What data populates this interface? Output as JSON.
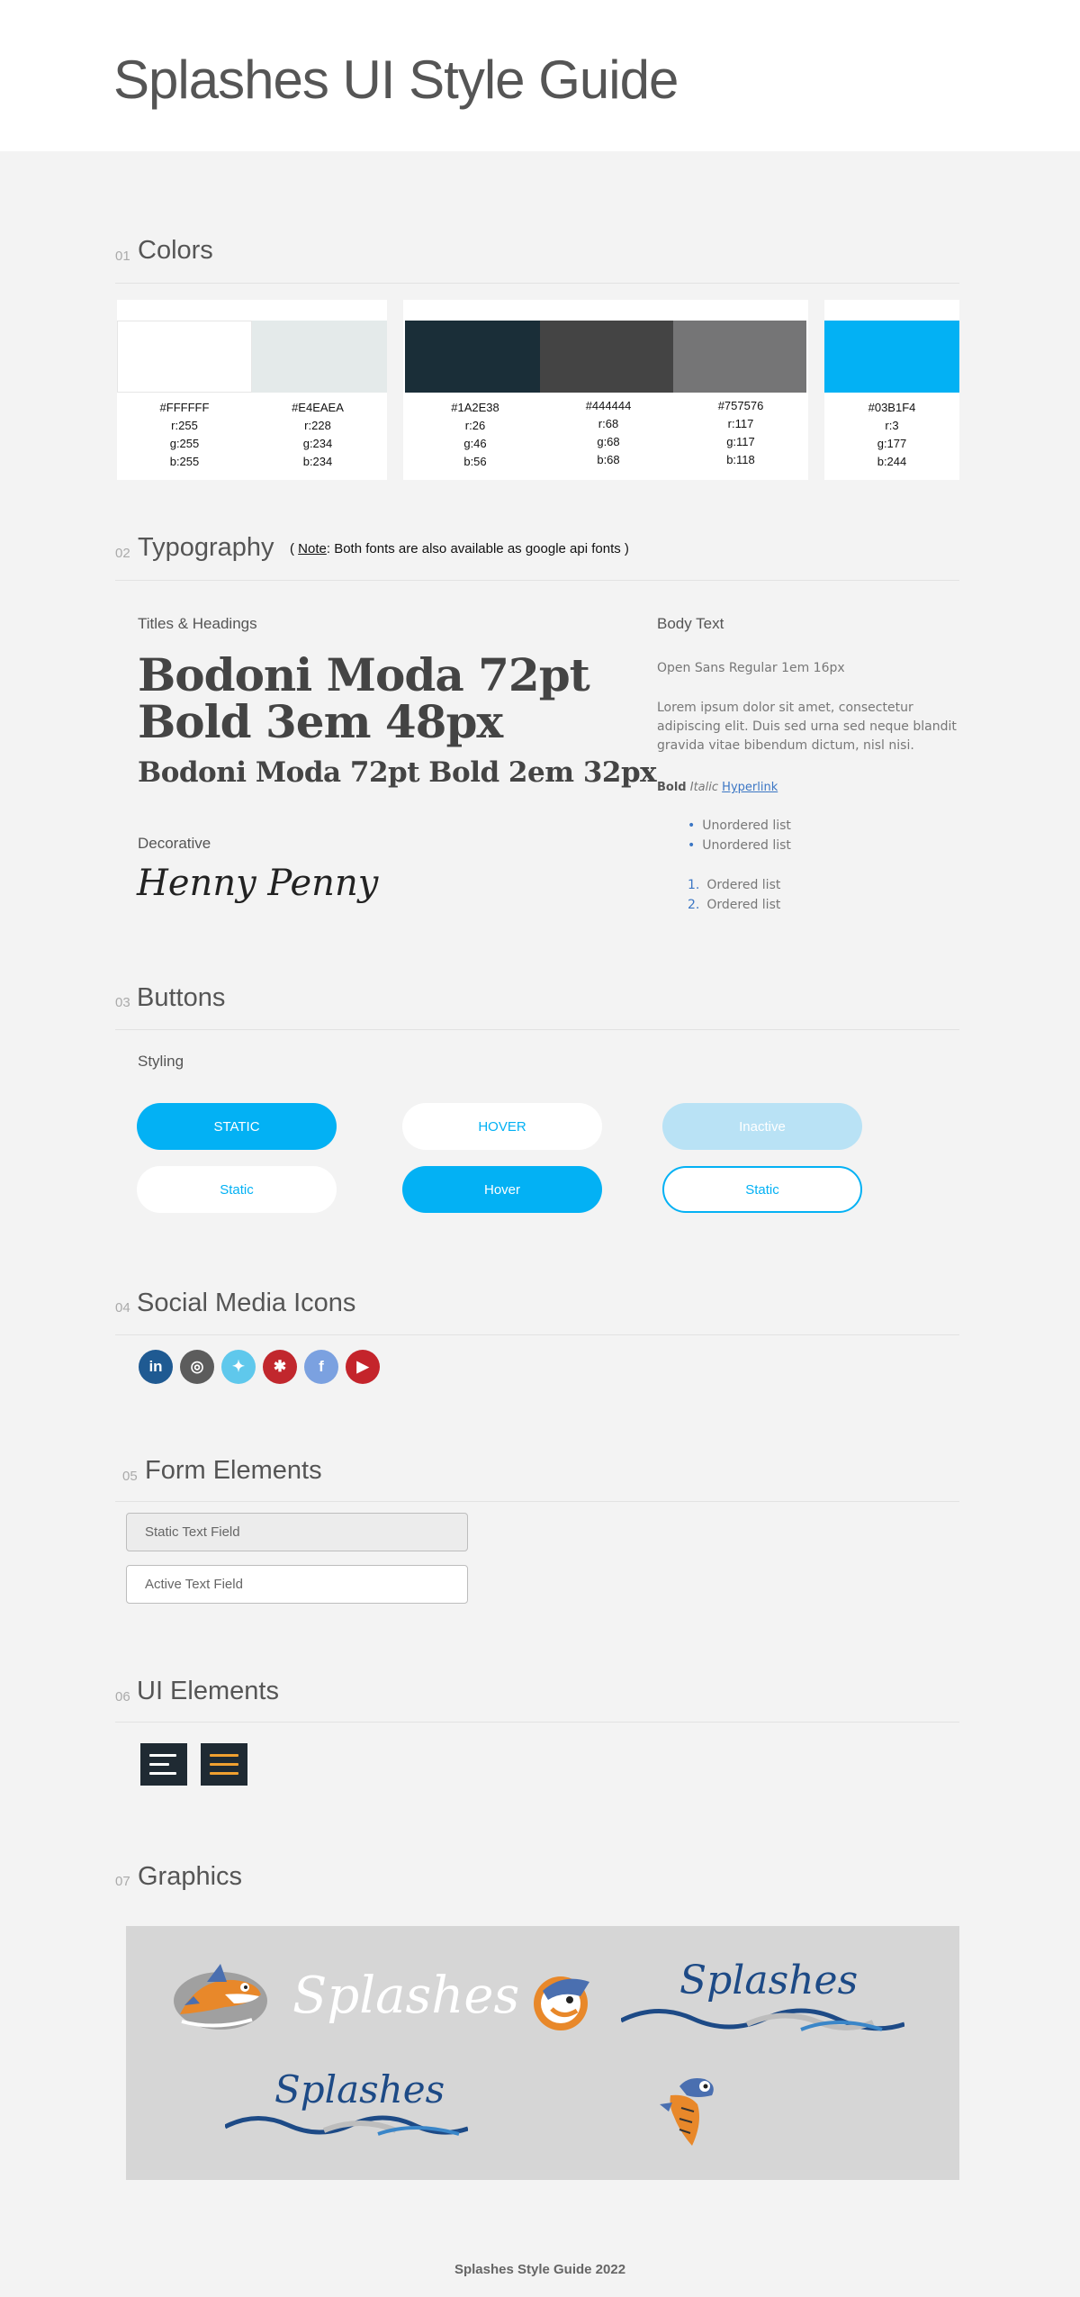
{
  "header": {
    "title": "Splashes UI Style Guide"
  },
  "sections": {
    "colors": {
      "num": "01",
      "title": "Colors"
    },
    "typography": {
      "num": "02",
      "title": "Typography"
    },
    "buttons": {
      "num": "03",
      "title": "Buttons"
    },
    "social": {
      "num": "04",
      "title": "Social Media Icons"
    },
    "forms": {
      "num": "05",
      "title": "Form Elements"
    },
    "ui": {
      "num": "06",
      "title": "UI Elements"
    },
    "graphics": {
      "num": "07",
      "title": "Graphics"
    }
  },
  "colors": [
    {
      "hex": "#FFFFFF",
      "r": "r:255",
      "g": "g:255",
      "b": "b:255",
      "value": "#FFFFFF"
    },
    {
      "hex": "#E4EAEA",
      "r": "r:228",
      "g": "g:234",
      "b": "b:234",
      "value": "#E4EAEA"
    },
    {
      "hex": "#1A2E38",
      "r": "r:26",
      "g": "g:46",
      "b": "b:56",
      "value": "#1A2E38"
    },
    {
      "hex": "#444444",
      "r": "r:68",
      "g": "g:68",
      "b": "b:68",
      "value": "#444444"
    },
    {
      "hex": "#757576",
      "r": "r:117",
      "g": "g:117",
      "b": "b:118",
      "value": "#757576"
    },
    {
      "hex": "#03B1F4",
      "r": "r:3",
      "g": "g:177",
      "b": "b:244",
      "value": "#03B1F4"
    }
  ],
  "typography": {
    "note_open": "( ",
    "note_label": "Note",
    "note_rest": ": Both fonts are also available as google api fonts )",
    "titles_heading": "Titles & Headings",
    "bodoni_line1": "Bodoni Moda 72pt",
    "bodoni_line2": "Bold 3em 48px",
    "bodoni_small": "Bodoni Moda 72pt  Bold  2em 32px",
    "decorative_heading": "Decorative",
    "decorative_sample": "Henny Penny",
    "body_heading": "Body Text",
    "body_font": "Open Sans  Regular 1em 16px",
    "lorem": "Lorem ipsum dolor sit amet, consectetur adipiscing elit. Duis sed urna sed neque blandit gravida vitae bibendum dictum, nisl nisi.",
    "bold": "Bold",
    "italic": "Italic",
    "hyperlink": "Hyperlink",
    "unordered": [
      "Unordered list",
      "Unordered list"
    ],
    "ordered": [
      "Ordered list",
      "Ordered list"
    ],
    "ordered_nums": [
      "1.",
      "2."
    ]
  },
  "buttons": {
    "styling_heading": "Styling",
    "static_caps": "STATIC",
    "hover_caps": "HOVER",
    "inactive": "Inactive",
    "static": "Static",
    "hover": "Hover",
    "static_outline": "Static"
  },
  "social_icons": [
    {
      "name": "linkedin-icon",
      "glyph": "in",
      "color": "#1f5a92"
    },
    {
      "name": "instagram-icon",
      "glyph": "◎",
      "color": "#5c5c5c"
    },
    {
      "name": "twitter-icon",
      "glyph": "✦",
      "color": "#5fc8ec"
    },
    {
      "name": "yelp-icon",
      "glyph": "✱",
      "color": "#c1272d"
    },
    {
      "name": "facebook-icon",
      "glyph": "f",
      "color": "#7ba1e0"
    },
    {
      "name": "youtube-icon",
      "glyph": "▶",
      "color": "#c4242b"
    }
  ],
  "forms": {
    "static_field": "Static Text Field",
    "active_field": "Active Text Field"
  },
  "graphics": {
    "wordmark": "Splashes"
  },
  "footer": "Splashes Style Guide 2022"
}
